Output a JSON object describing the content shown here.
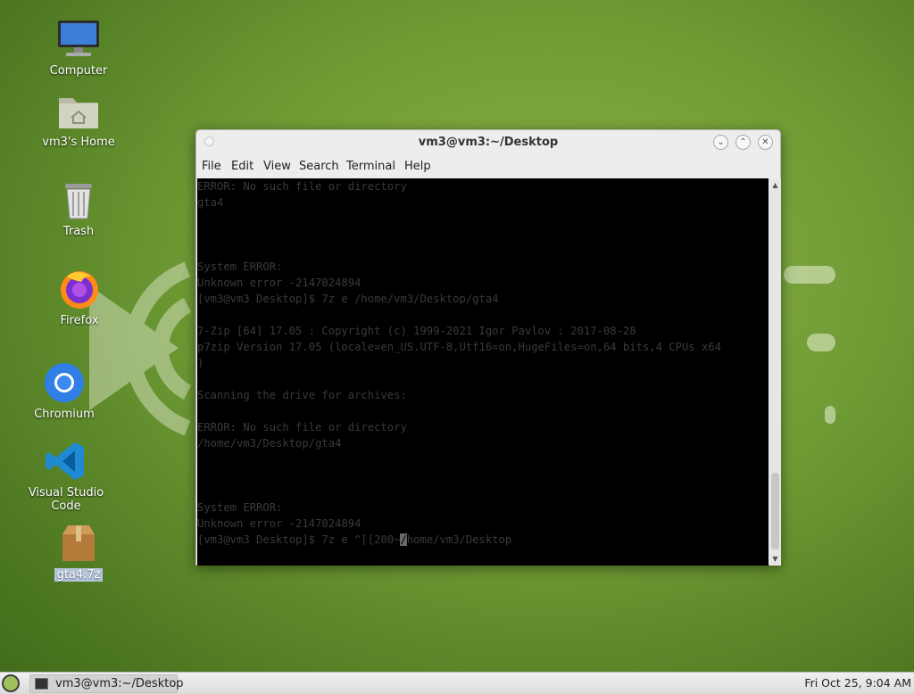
{
  "desktop": {
    "icons": [
      {
        "label": "Computer"
      },
      {
        "label": "vm3's Home"
      },
      {
        "label": "Trash"
      },
      {
        "label": "Firefox"
      },
      {
        "label": "Chromium"
      },
      {
        "label": "Visual Studio Code"
      },
      {
        "label": "gta4.7z"
      }
    ]
  },
  "window": {
    "title": "vm3@vm3:~/Desktop",
    "buttons": {
      "minimize": "⌄",
      "maximize": "⌃",
      "close": "✕"
    },
    "menu": [
      "File",
      "Edit",
      "View",
      "Search",
      "Terminal",
      "Help"
    ]
  },
  "terminal": {
    "lines": [
      "ERROR: No such file or directory",
      "gta4",
      "",
      "",
      "",
      "System ERROR:",
      "Unknown error -2147024894",
      "[vm3@vm3 Desktop]$ 7z e /home/vm3/Desktop/gta4",
      "",
      "7-Zip [64] 17.05 : Copyright (c) 1999-2021 Igor Pavlov : 2017-08-28",
      "p7zip Version 17.05 (locale=en_US.UTF-8,Utf16=on,HugeFiles=on,64 bits,4 CPUs x64",
      ")",
      "",
      "Scanning the drive for archives:",
      "",
      "ERROR: No such file or directory",
      "/home/vm3/Desktop/gta4",
      "",
      "",
      "",
      "System ERROR:",
      "Unknown error -2147024894"
    ],
    "prompt_before_cursor": "[vm3@vm3 Desktop]$ 7z e ^[[200~",
    "prompt_cursor_char": "/",
    "prompt_after_cursor": "home/vm3/Desktop"
  },
  "taskbar": {
    "task_label": "vm3@vm3:~/Desktop",
    "clock": "Fri Oct 25,  9:04 AM"
  },
  "colors": {
    "wallpaper": "#6e9a34",
    "terminal_bg": "#000000",
    "terminal_text": "#3a3a3a"
  }
}
